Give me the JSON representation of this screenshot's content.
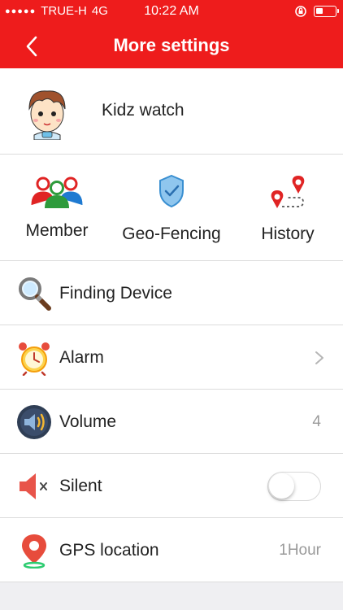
{
  "status_bar": {
    "carrier": "TRUE-H",
    "network": "4G",
    "time": "10:22 AM"
  },
  "nav": {
    "title": "More settings"
  },
  "profile": {
    "name": "Kidz watch"
  },
  "quick_actions": [
    {
      "label": "Member",
      "icon": "member-group-icon"
    },
    {
      "label": "Geo-Fencing",
      "icon": "shield-icon"
    },
    {
      "label": "History",
      "icon": "route-pins-icon"
    }
  ],
  "settings": [
    {
      "label": "Finding Device",
      "icon": "magnifier-icon",
      "value": ""
    },
    {
      "label": "Alarm",
      "icon": "alarm-clock-icon",
      "value": ""
    },
    {
      "label": "Volume",
      "icon": "speaker-icon",
      "value": "4"
    },
    {
      "label": "Silent",
      "icon": "mute-speaker-icon",
      "value": "",
      "toggle_on": false
    },
    {
      "label": "GPS location",
      "icon": "location-pin-icon",
      "value": "1Hour"
    }
  ],
  "colors": {
    "header": "#ee1c1c",
    "divider": "#dcdcdc",
    "value_text": "#9a9a9a"
  }
}
